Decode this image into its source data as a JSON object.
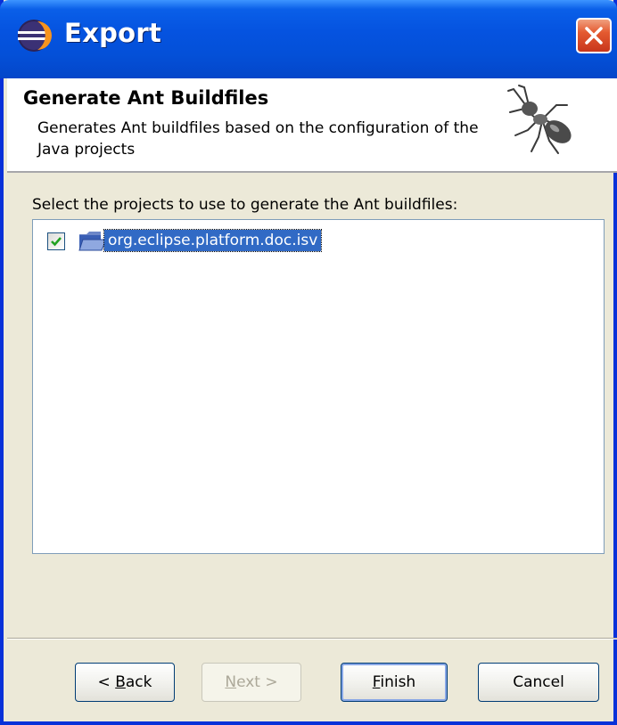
{
  "window": {
    "title": "Export",
    "app_icon": "eclipse-icon",
    "close_icon": "close-icon"
  },
  "banner": {
    "title": "Generate Ant Buildfiles",
    "description": "Generates Ant buildfiles based on the configuration of the Java projects",
    "image": "ant-icon"
  },
  "content": {
    "instruction": "Select the projects to use to generate the Ant buildfiles:",
    "projects": [
      {
        "name": "org.eclipse.platform.doc.isv",
        "checked": true,
        "selected": true,
        "icon": "project-folder-icon"
      }
    ]
  },
  "buttons": {
    "back": {
      "prefix": "< ",
      "mnemonic": "B",
      "rest": "ack",
      "enabled": true
    },
    "next": {
      "mnemonic": "N",
      "rest": "ext >",
      "enabled": false
    },
    "finish": {
      "mnemonic": "F",
      "rest": "inish",
      "enabled": true,
      "default": true
    },
    "cancel": {
      "label": "Cancel",
      "enabled": true
    }
  },
  "colors": {
    "titlebar": "#0553e0",
    "selection": "#316ac5",
    "dialog_bg": "#ece9d8"
  }
}
